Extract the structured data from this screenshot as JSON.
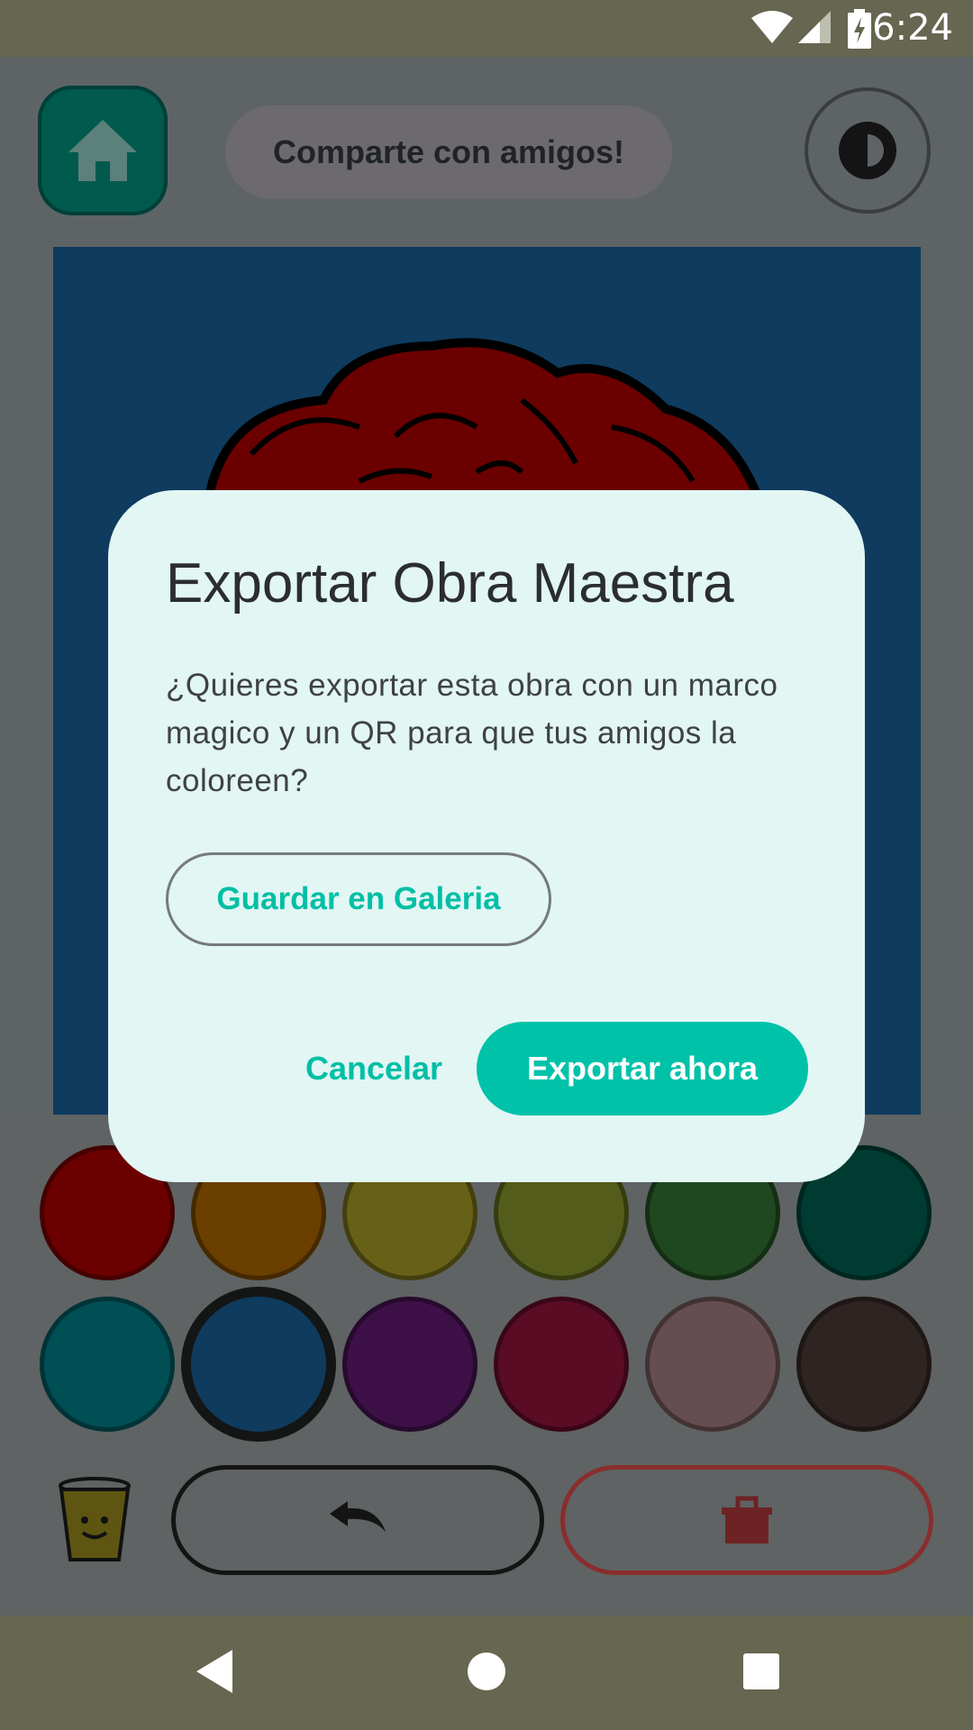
{
  "status_bar": {
    "time": "6:24",
    "icons": [
      "wifi-icon",
      "cell-signal-icon",
      "battery-charging-icon"
    ]
  },
  "toolbar": {
    "home_icon": "home-icon",
    "share_label": "Comparte con amigos!",
    "theme_icon": "contrast-icon"
  },
  "palette": {
    "colors": [
      "#6b0000",
      "#6b3f00",
      "#676117",
      "#535c1a",
      "#1f4820",
      "#003b32",
      "#004f55",
      "#0e3b5e",
      "#3d1047",
      "#5a0c25",
      "#664d51",
      "#2e2421"
    ],
    "selected_index": 7
  },
  "bottom_bar": {
    "cup_icon": "paint-cup-icon",
    "undo_icon": "undo-icon",
    "trash_icon": "trash-icon"
  },
  "dialog": {
    "title": "Exportar Obra Maestra",
    "message": "¿Quieres exportar esta obra con un marco magico y un QR para que tus amigos la coloreen?",
    "gallery_label": "Guardar en Galeria",
    "cancel_label": "Cancelar",
    "export_label": "Exportar ahora"
  },
  "nav_bar": {
    "icons": [
      "back-icon",
      "home-circle-icon",
      "recents-icon"
    ]
  }
}
